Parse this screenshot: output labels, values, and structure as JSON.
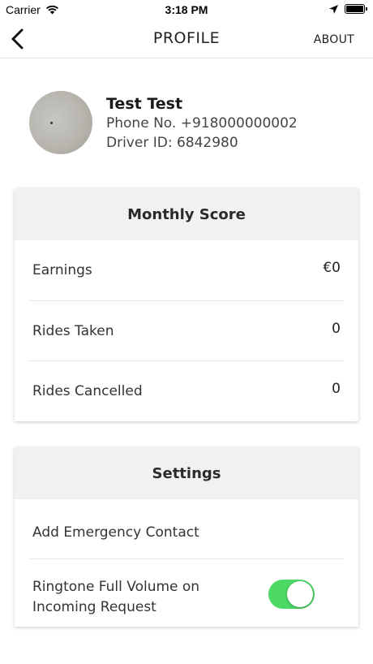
{
  "status_bar": {
    "carrier": "Carrier",
    "time": "3:18 PM",
    "icons": [
      "wifi-icon",
      "location-icon",
      "battery-icon"
    ]
  },
  "nav": {
    "title": "PROFILE",
    "about_label": "ABOUT",
    "back_icon": "chevron-left-icon"
  },
  "profile": {
    "name": "Test Test",
    "phone_label": "Phone No.",
    "phone": "+918000000002",
    "driver_id_label": "Driver ID:",
    "driver_id": "6842980"
  },
  "monthly_score": {
    "title": "Monthly Score",
    "rows": [
      {
        "label": "Earnings",
        "value": "€0"
      },
      {
        "label": "Rides Taken",
        "value": "0"
      },
      {
        "label": "Rides Cancelled",
        "value": "0"
      }
    ]
  },
  "settings": {
    "title": "Settings",
    "emergency_contact_label": "Add Emergency Contact",
    "ringtone_label": "Ringtone Full Volume on Incoming Request",
    "ringtone_enabled": true
  },
  "colors": {
    "toggle_on": "#4cd964",
    "card_header_bg": "#f1f1f1"
  }
}
